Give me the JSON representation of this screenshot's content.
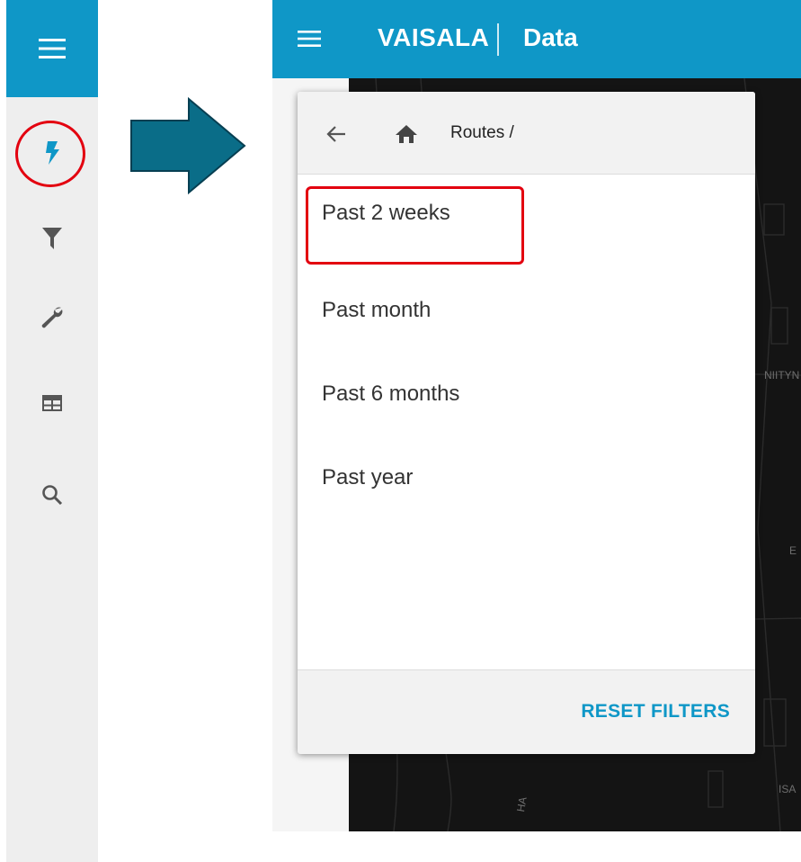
{
  "sidebar": {
    "menu_icon": "hamburger-icon",
    "items": [
      {
        "icon": "lightning-icon",
        "active": true,
        "color": "#0f97c7"
      },
      {
        "icon": "filter-icon"
      },
      {
        "icon": "wrench-icon"
      },
      {
        "icon": "table-icon"
      },
      {
        "icon": "search-icon"
      }
    ]
  },
  "colors": {
    "accent": "#0f97c7",
    "highlight": "#e3000f",
    "arrow": "#0a6d88"
  },
  "app": {
    "brand": "VAISALA",
    "title": "Data"
  },
  "panel": {
    "breadcrumb": "Routes /",
    "filters": [
      "Past 2 weeks",
      "Past month",
      "Past 6 months",
      "Past year"
    ],
    "selected": "Past 2 weeks",
    "reset_label": "RESET FILTERS"
  },
  "map": {
    "labels": [
      "NIITYN",
      "E",
      "ISA",
      "HA"
    ]
  }
}
